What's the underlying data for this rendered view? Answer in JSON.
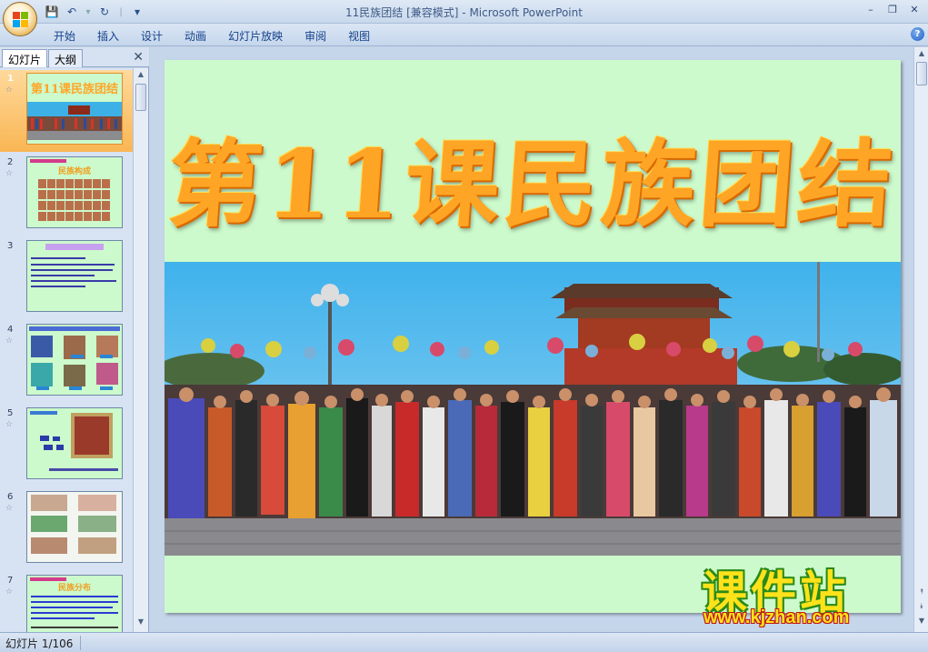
{
  "window": {
    "title": "11民族团结 [兼容模式] - Microsoft PowerPoint",
    "minimize_glyph": "–",
    "restore_glyph": "❐",
    "close_glyph": "✕"
  },
  "quick_access": {
    "save_icon": "💾",
    "undo_icon": "↶",
    "redo_icon": "↻",
    "customize_icon": "▾"
  },
  "ribbon": {
    "tabs": [
      "开始",
      "插入",
      "设计",
      "动画",
      "幻灯片放映",
      "审阅",
      "视图"
    ],
    "help_glyph": "?"
  },
  "left_pane": {
    "tabs": [
      "幻灯片",
      "大纲"
    ],
    "close_glyph": "✕",
    "thumbnails": [
      {
        "num": "1",
        "selected": true,
        "title": "第11课民族团结"
      },
      {
        "num": "2",
        "selected": false,
        "title": "民族构成"
      },
      {
        "num": "3",
        "selected": false,
        "title": ""
      },
      {
        "num": "4",
        "selected": false,
        "title": ""
      },
      {
        "num": "5",
        "selected": false,
        "title": ""
      },
      {
        "num": "6",
        "selected": false,
        "title": ""
      },
      {
        "num": "7",
        "selected": false,
        "title": "民族分布"
      }
    ]
  },
  "slide": {
    "title": "第11课民族团结",
    "background_color": "#ccfacc",
    "title_color": "#ffa526"
  },
  "watermark": {
    "big_text": "课件站",
    "small_text": "www.kjzhan.com"
  },
  "status_bar": {
    "slide_indicator": "幻灯片 1/106"
  }
}
